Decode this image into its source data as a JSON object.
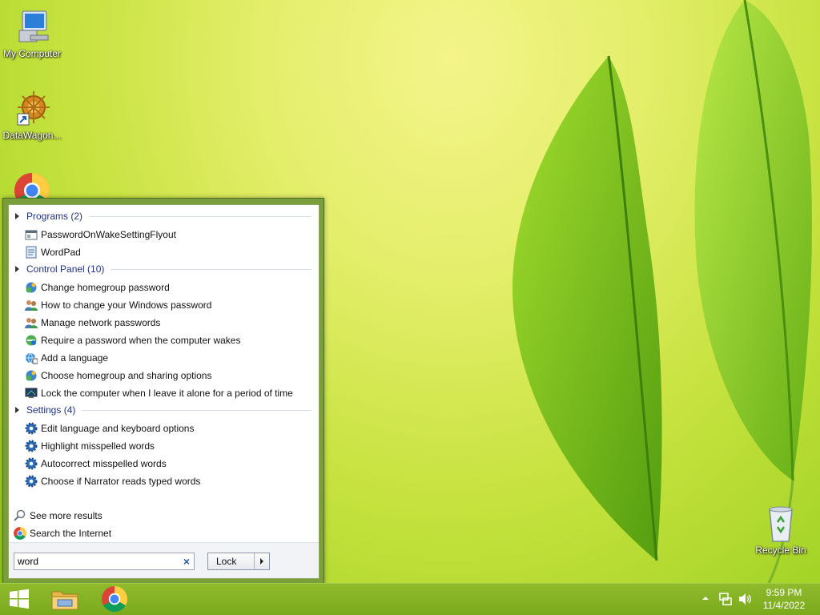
{
  "desktop": {
    "icons": [
      {
        "label": "My Computer"
      },
      {
        "label": "DataWagon..."
      },
      {
        "label": "Recycle Bin"
      }
    ]
  },
  "start_menu": {
    "groups": [
      {
        "title": "Programs (2)",
        "items": [
          "PasswordOnWakeSettingFlyout",
          "WordPad"
        ]
      },
      {
        "title": "Control Panel (10)",
        "items": [
          "Change homegroup password",
          "How to change your Windows password",
          "Manage network passwords",
          "Require a password when the computer wakes",
          "Add a language",
          "Choose homegroup and sharing options",
          "Lock the computer when I leave it alone for a period of time"
        ]
      },
      {
        "title": "Settings (4)",
        "items": [
          "Edit language and keyboard options",
          "Highlight misspelled words",
          "Autocorrect misspelled words",
          "Choose if Narrator reads typed words"
        ]
      }
    ],
    "see_more": "See more results",
    "search_internet": "Search the Internet",
    "search_value": "word",
    "clear_glyph": "×",
    "lock_label": "Lock"
  },
  "taskbar": {
    "time": "9:59 PM",
    "date": "11/4/2022"
  },
  "colors": {
    "accent": "#7a9e3a",
    "group_title": "#1e3287"
  }
}
